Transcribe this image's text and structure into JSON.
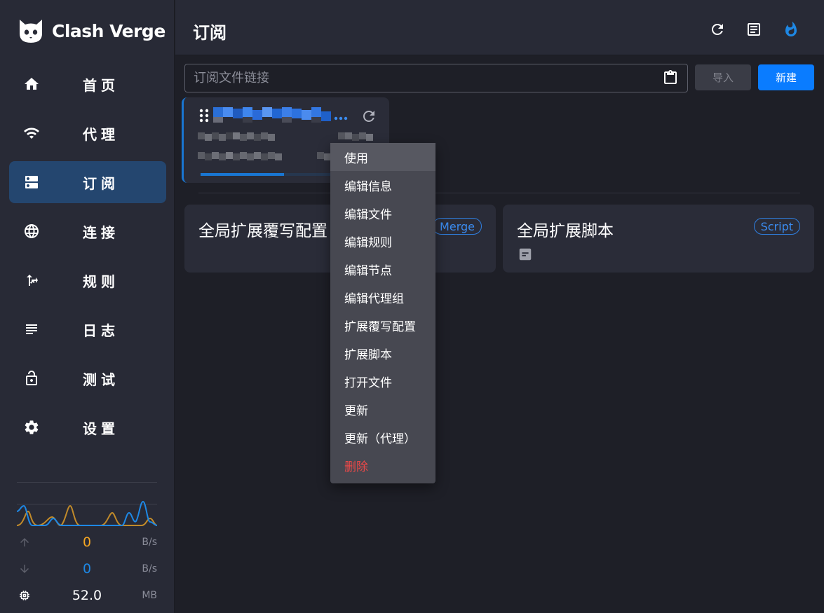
{
  "app": {
    "name": "Clash Verge",
    "accent_color": "#0a7cff",
    "active_nav_color": "#24466f"
  },
  "sidebar": {
    "items": [
      {
        "label": "首页",
        "icon": "home-icon",
        "active": false
      },
      {
        "label": "代理",
        "icon": "wifi-icon",
        "active": false
      },
      {
        "label": "订阅",
        "icon": "dns-icon",
        "active": true
      },
      {
        "label": "连接",
        "icon": "globe-icon",
        "active": false
      },
      {
        "label": "规则",
        "icon": "fork-right-icon",
        "active": false
      },
      {
        "label": "日志",
        "icon": "subject-icon",
        "active": false
      },
      {
        "label": "测试",
        "icon": "lock-open-icon",
        "active": false
      },
      {
        "label": "设置",
        "icon": "gear-icon",
        "active": false
      }
    ],
    "traffic": {
      "upload_value": "0",
      "upload_unit": "B/s",
      "upload_color": "#f5a623",
      "download_value": "0",
      "download_unit": "B/s",
      "download_color": "#1e88e5",
      "memory_value": "52.0",
      "memory_unit": "MB"
    }
  },
  "header": {
    "title": "订阅",
    "buttons": [
      "refresh-icon",
      "document-icon",
      "flame-icon"
    ]
  },
  "toolbar": {
    "url_placeholder": "订阅文件链接",
    "url_value": "",
    "import_label": "导入",
    "new_label": "新建"
  },
  "profile_card": {
    "progress_percent": 57
  },
  "extensions": [
    {
      "title": "全局扩展覆写配置",
      "badge": "Merge"
    },
    {
      "title": "全局扩展脚本",
      "badge": "Script"
    }
  ],
  "context_menu": {
    "items": [
      {
        "label": "使用",
        "hover": true,
        "danger": false
      },
      {
        "label": "编辑信息",
        "hover": false,
        "danger": false
      },
      {
        "label": "编辑文件",
        "hover": false,
        "danger": false
      },
      {
        "label": "编辑规则",
        "hover": false,
        "danger": false
      },
      {
        "label": "编辑节点",
        "hover": false,
        "danger": false
      },
      {
        "label": "编辑代理组",
        "hover": false,
        "danger": false
      },
      {
        "label": "扩展覆写配置",
        "hover": false,
        "danger": false
      },
      {
        "label": "扩展脚本",
        "hover": false,
        "danger": false
      },
      {
        "label": "打开文件",
        "hover": false,
        "danger": false
      },
      {
        "label": "更新",
        "hover": false,
        "danger": false
      },
      {
        "label": "更新（代理）",
        "hover": false,
        "danger": false
      },
      {
        "label": "删除",
        "hover": false,
        "danger": true
      }
    ]
  }
}
